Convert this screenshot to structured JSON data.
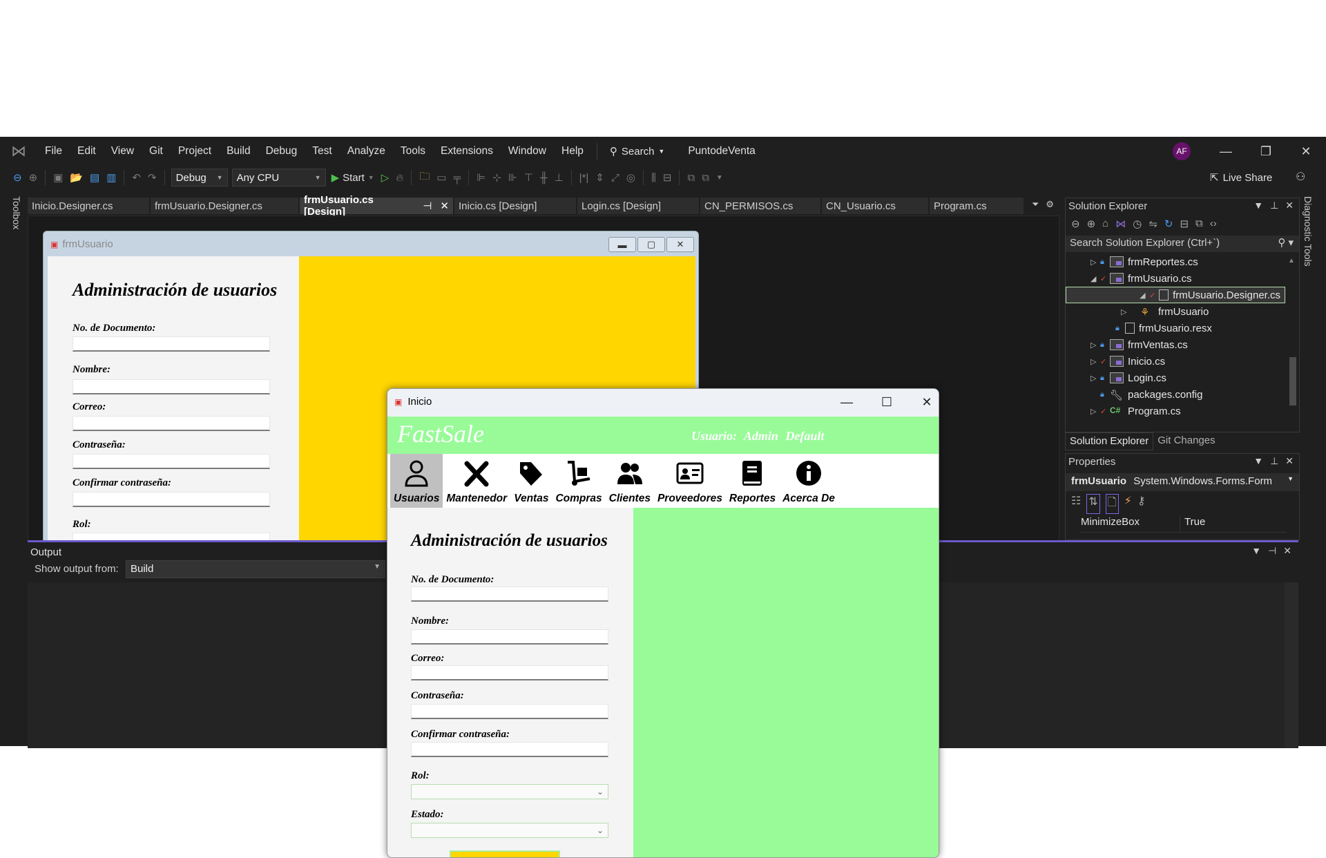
{
  "menubar": {
    "items": [
      "File",
      "Edit",
      "View",
      "Git",
      "Project",
      "Build",
      "Debug",
      "Test",
      "Analyze",
      "Tools",
      "Extensions",
      "Window",
      "Help"
    ],
    "search_label": "Search",
    "project_name": "PuntodeVenta",
    "avatar_initials": "AF"
  },
  "toolbar": {
    "configuration": "Debug",
    "platform": "Any CPU",
    "start_label": "Start",
    "live_share_label": "Live Share"
  },
  "side_labels": {
    "toolbox": "Toolbox",
    "diagnostic_tools": "Diagnostic Tools"
  },
  "tabs": [
    {
      "label": "Inicio.Designer.cs",
      "active": false
    },
    {
      "label": "frmUsuario.Designer.cs",
      "active": false
    },
    {
      "label": "frmUsuario.cs [Design]",
      "active": true
    },
    {
      "label": "Inicio.cs [Design]",
      "active": false
    },
    {
      "label": "Login.cs [Design]",
      "active": false
    },
    {
      "label": "CN_PERMISOS.cs",
      "active": false
    },
    {
      "label": "CN_Usuario.cs",
      "active": false
    },
    {
      "label": "Program.cs",
      "active": false
    }
  ],
  "frmUsuario": {
    "title": "frmUsuario",
    "heading": "Administración de usuarios",
    "fields": [
      "No. de Documento:",
      "Nombre:",
      "Correo:",
      "Contraseña:",
      "Confirmar contraseña:",
      "Rol:"
    ]
  },
  "inicio": {
    "title": "Inicio",
    "brand": "FastSale",
    "user_label": "Usuario:",
    "user_name": "Admin Default",
    "menu": [
      {
        "label": "Usuarios",
        "icon": "user-icon",
        "active": true
      },
      {
        "label": "Mantenedor",
        "icon": "tools-icon",
        "active": false
      },
      {
        "label": "Ventas",
        "icon": "tag-icon",
        "active": false
      },
      {
        "label": "Compras",
        "icon": "dolly-icon",
        "active": false
      },
      {
        "label": "Clientes",
        "icon": "users-icon",
        "active": false
      },
      {
        "label": "Proveedores",
        "icon": "id-card-icon",
        "active": false
      },
      {
        "label": "Reportes",
        "icon": "book-icon",
        "active": false
      },
      {
        "label": "Acerca De",
        "icon": "info-icon",
        "active": false
      }
    ],
    "form": {
      "heading": "Administración de usuarios",
      "documento_label": "No. de Documento:",
      "nombre_label": "Nombre:",
      "correo_label": "Correo:",
      "contrasena_label": "Contraseña:",
      "confirmar_label": "Confirmar contraseña:",
      "rol_label": "Rol:",
      "estado_label": "Estado:",
      "documento_value": "",
      "nombre_value": "",
      "correo_value": "",
      "contrasena_value": "",
      "confirmar_value": "",
      "rol_value": "",
      "estado_value": ""
    },
    "colors": {
      "header": "#98fb98",
      "accent_button": "#ffd600"
    }
  },
  "output": {
    "title": "Output",
    "show_from_label": "Show output from:",
    "source": "Build"
  },
  "solution_explorer": {
    "title": "Solution Explorer",
    "search_placeholder": "Search Solution Explorer (Ctrl+`)",
    "items": [
      {
        "label": "frmReportes.cs",
        "indent": 1,
        "expander": "collapsed",
        "status": "lock",
        "type": "form"
      },
      {
        "label": "frmUsuario.cs",
        "indent": 1,
        "expander": "expanded",
        "status": "check",
        "type": "form"
      },
      {
        "label": "frmUsuario.Designer.cs",
        "indent": 2,
        "expander": "expanded",
        "status": "check",
        "type": "file",
        "selected": true
      },
      {
        "label": "frmUsuario",
        "indent": 3,
        "expander": "collapsed",
        "status": "",
        "type": "class"
      },
      {
        "label": "frmUsuario.resx",
        "indent": 2,
        "expander": "",
        "status": "lock",
        "type": "file"
      },
      {
        "label": "frmVentas.cs",
        "indent": 1,
        "expander": "collapsed",
        "status": "lock",
        "type": "form"
      },
      {
        "label": "Inicio.cs",
        "indent": 1,
        "expander": "collapsed",
        "status": "check",
        "type": "form"
      },
      {
        "label": "Login.cs",
        "indent": 1,
        "expander": "collapsed",
        "status": "lock",
        "type": "form"
      },
      {
        "label": "packages.config",
        "indent": 1,
        "expander": "",
        "status": "lock",
        "type": "config"
      },
      {
        "label": "Program.cs",
        "indent": 1,
        "expander": "collapsed",
        "status": "check",
        "type": "csharp"
      }
    ],
    "bottom_tabs": [
      "Solution Explorer",
      "Git Changes"
    ]
  },
  "properties": {
    "title": "Properties",
    "object_name": "frmUsuario",
    "object_type": "System.Windows.Forms.Form",
    "rows": [
      {
        "name": "MinimizeBox",
        "value": "True"
      }
    ]
  }
}
